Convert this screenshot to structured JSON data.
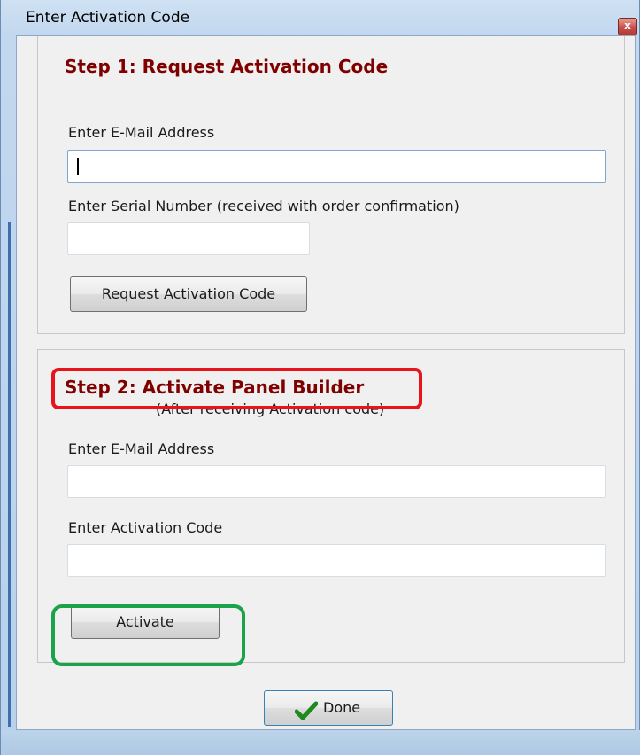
{
  "window": {
    "title": "Enter Activation Code",
    "close_glyph": "x"
  },
  "step1": {
    "heading": "Step 1: Request Activation Code",
    "email_label": "Enter E-Mail Address",
    "email_value": "",
    "serial_label": "Enter Serial Number (received with order confirmation)",
    "serial_value": "",
    "request_button": "Request Activation Code"
  },
  "step2": {
    "heading": "Step 2: Activate Panel Builder",
    "subheading": "(After receiving Activation code)",
    "email_label": "Enter E-Mail Address",
    "email_value": "",
    "code_label": "Enter Activation Code",
    "code_value": "",
    "activate_button": "Activate"
  },
  "footer": {
    "done_button": "Done",
    "done_icon": "checkmark-icon"
  },
  "annotations": {
    "step2_heading_outline": "#e8141b",
    "activate_outline": "#1aa34a"
  },
  "colors": {
    "heading": "#800000"
  }
}
